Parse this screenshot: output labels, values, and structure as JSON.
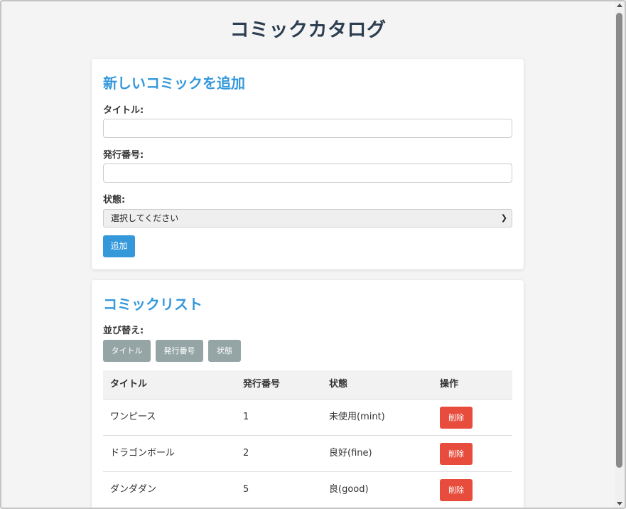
{
  "page": {
    "title": "コミックカタログ"
  },
  "add_form": {
    "heading": "新しいコミックを追加",
    "title_label": "タイトル:",
    "title_value": "",
    "issue_label": "発行番号:",
    "issue_value": "",
    "condition_label": "状態:",
    "condition_selected": "選択してください",
    "submit_label": "追加"
  },
  "list": {
    "heading": "コミックリスト",
    "sort_label": "並び替え:",
    "sort_buttons": [
      "タイトル",
      "発行番号",
      "状態"
    ],
    "columns": [
      "タイトル",
      "発行番号",
      "状態",
      "操作"
    ],
    "rows": [
      {
        "title": "ワンピース",
        "issue": "1",
        "condition": "未使用(mint)",
        "action": "削除"
      },
      {
        "title": "ドラゴンボール",
        "issue": "2",
        "condition": "良好(fine)",
        "action": "削除"
      },
      {
        "title": "ダンダダン",
        "issue": "5",
        "condition": "良(good)",
        "action": "削除"
      }
    ]
  },
  "colors": {
    "heading": "#2c3e50",
    "accent": "#3498db",
    "sort_button": "#95a5a6",
    "delete_button": "#e74c3c"
  }
}
